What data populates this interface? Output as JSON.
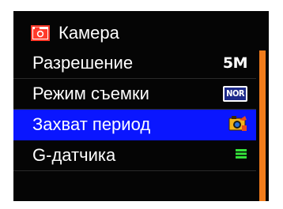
{
  "header": {
    "title": "Камера",
    "icon": "camera-icon",
    "icon_color": "#ff3a2a"
  },
  "menu": {
    "items": [
      {
        "label": "Разрешение",
        "value": "5M",
        "value_kind": "text"
      },
      {
        "label": "Режим съемки",
        "value": "NOR",
        "value_kind": "badge"
      },
      {
        "label": "Захват период",
        "value": "",
        "value_kind": "icon",
        "icon": "interval-capture-icon",
        "selected": true
      },
      {
        "label": "G-датчика",
        "value": "",
        "value_kind": "icon",
        "icon": "g-sensor-icon"
      }
    ]
  },
  "colors": {
    "background": "#050505",
    "selection": "#0a16ff",
    "scrollbar": "#f27c1b",
    "text": "#ffffff",
    "g_sensor": "#34e23a"
  }
}
